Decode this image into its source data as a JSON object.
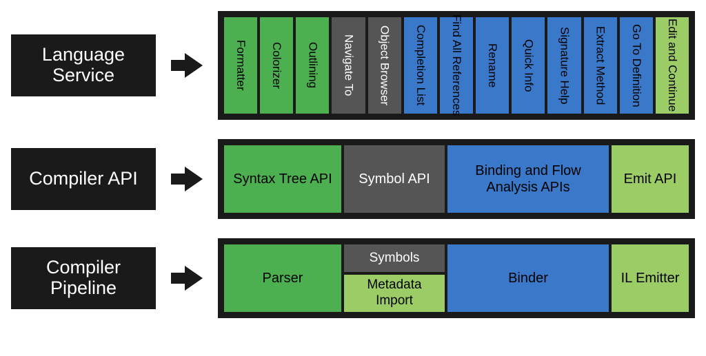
{
  "colors": {
    "frame": "#1a1a1a",
    "green": "#4caf50",
    "gray": "#555555",
    "blue": "#3a78c9",
    "lightgreen": "#9ccc65"
  },
  "rows": {
    "language_service": {
      "label": "Language Service",
      "items": [
        {
          "label": "Formatter",
          "color": "green"
        },
        {
          "label": "Colorizer",
          "color": "green"
        },
        {
          "label": "Outlining",
          "color": "green"
        },
        {
          "label": "Navigate To",
          "color": "gray"
        },
        {
          "label": "Object Browser",
          "color": "gray"
        },
        {
          "label": "Completion List",
          "color": "blue"
        },
        {
          "label": "Find All References",
          "color": "blue"
        },
        {
          "label": "Rename",
          "color": "blue"
        },
        {
          "label": "Quick Info",
          "color": "blue"
        },
        {
          "label": "Signature Help",
          "color": "blue"
        },
        {
          "label": "Extract Method",
          "color": "blue"
        },
        {
          "label": "Go To Definition",
          "color": "blue"
        },
        {
          "label": "Edit and Continue",
          "color": "lightgreen"
        }
      ]
    },
    "compiler_api": {
      "label": "Compiler API",
      "items": [
        {
          "label": "Syntax Tree API",
          "color": "green",
          "width": "syntax"
        },
        {
          "label": "Symbol API",
          "color": "gray",
          "width": "symbol"
        },
        {
          "label": "Binding and Flow Analysis APIs",
          "color": "blue",
          "width": "binding"
        },
        {
          "label": "Emit API",
          "color": "lightgreen",
          "width": "emit"
        }
      ]
    },
    "compiler_pipeline": {
      "label": "Compiler Pipeline",
      "parser": {
        "label": "Parser",
        "color": "green"
      },
      "symbols": {
        "label": "Symbols",
        "color": "gray"
      },
      "metadata_import": {
        "label": "Metadata Import",
        "color": "lightgreen"
      },
      "binder": {
        "label": "Binder",
        "color": "blue"
      },
      "il_emitter": {
        "label": "IL Emitter",
        "color": "lightgreen"
      }
    }
  }
}
